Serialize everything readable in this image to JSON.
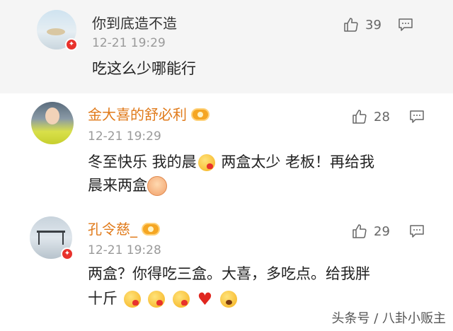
{
  "comments": [
    {
      "name": "你到底造不造",
      "time": "12-21 19:29",
      "text_lines": [
        "吃这么少哪能行"
      ],
      "likes": "39"
    },
    {
      "name": "金大喜的舒必利",
      "time": "12-21 19:29",
      "text_lines": [
        "冬至快乐 我的晨",
        "两盒太少 老板！再给我",
        "晨来两盒"
      ],
      "likes": "28"
    },
    {
      "name": "孔令慈_",
      "time": "12-21 19:28",
      "text_lines": [
        "两盒？你得吃三盒。大喜，多吃点。给我胖",
        "十斤"
      ],
      "likes": "29"
    }
  ],
  "icons": {
    "like": "thumbs-up-icon",
    "reply": "reply-icon",
    "verified": "verified-badge-icon",
    "vip": "vip-crown-icon"
  },
  "colors": {
    "vip_name": "#e07a1a",
    "verified_badge": "#e8322c",
    "highlight_bg": "#f5f5f5"
  },
  "watermark": "头条号 / 八卦小贩主"
}
